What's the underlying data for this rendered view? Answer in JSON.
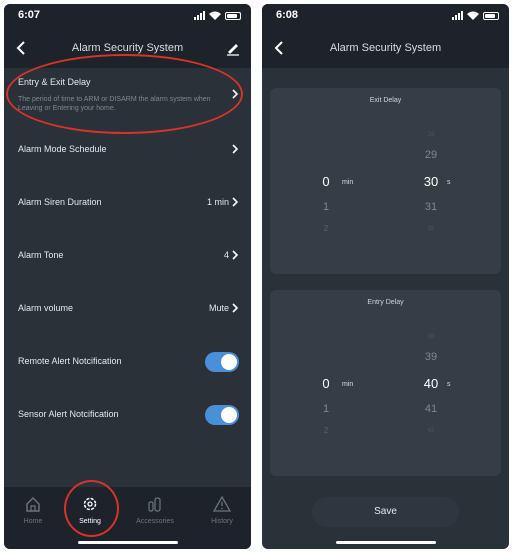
{
  "left": {
    "status": {
      "time": "6:07"
    },
    "nav": {
      "title": "Alarm Security System"
    },
    "rows": [
      {
        "label": "Entry & Exit Delay",
        "desc": "The period of time to ARM or DISARM the alarm system when Leaving or Entering your home."
      },
      {
        "label": "Alarm Mode Schedule",
        "value": ""
      },
      {
        "label": "Alarm Siren Duration",
        "value": "1 min"
      },
      {
        "label": "Alarm Tone",
        "value": "4"
      },
      {
        "label": "Alarm volume",
        "value": "Mute"
      },
      {
        "label": "Remote Alert Notcification",
        "toggle": true
      },
      {
        "label": "Sensor Alert Notcification",
        "toggle": true
      }
    ],
    "tabs": [
      {
        "label": "Home",
        "icon": "home-icon"
      },
      {
        "label": "Setting",
        "icon": "gear-icon",
        "active": true
      },
      {
        "label": "Accessories",
        "icon": "accessories-icon"
      },
      {
        "label": "History",
        "icon": "warning-icon"
      }
    ]
  },
  "right": {
    "status": {
      "time": "6:08"
    },
    "nav": {
      "title": "Alarm Security System"
    },
    "exit_delay": {
      "title": "Exit Delay",
      "min_col": {
        "selected": "0",
        "below1": "1",
        "below2": "2"
      },
      "min_unit": "min",
      "sec_col": {
        "above2": "28",
        "above1": "29",
        "selected": "30",
        "below1": "31",
        "below2": "32"
      },
      "sec_unit": "s"
    },
    "entry_delay": {
      "title": "Entry Delay",
      "min_col": {
        "selected": "0",
        "below1": "1",
        "below2": "2"
      },
      "min_unit": "min",
      "sec_col": {
        "above2": "38",
        "above1": "39",
        "selected": "40",
        "below1": "41",
        "below2": "42"
      },
      "sec_unit": "s"
    },
    "save_label": "Save"
  },
  "colors": {
    "background": "#2b3139",
    "bar": "#1e2329",
    "toggle_on": "#4a90d9",
    "highlight": "#d6322f"
  }
}
